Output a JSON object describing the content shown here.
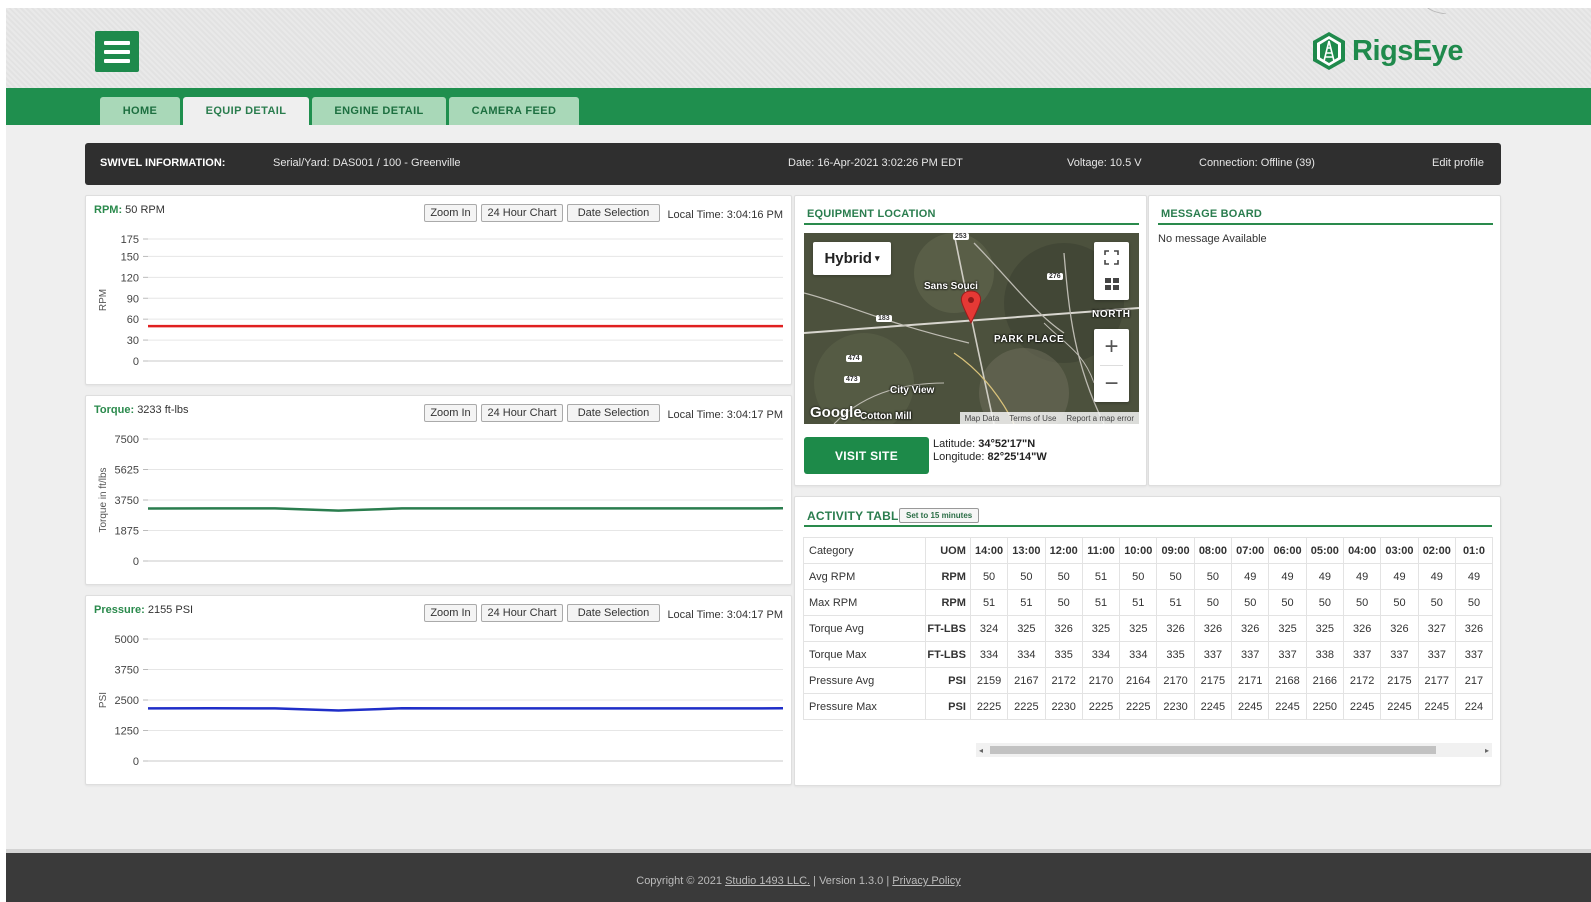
{
  "header": {
    "brand": "RigsEye"
  },
  "nav": {
    "tabs": [
      {
        "label": "HOME"
      },
      {
        "label": "EQUIP DETAIL"
      },
      {
        "label": "ENGINE DETAIL"
      },
      {
        "label": "CAMERA FEED"
      }
    ]
  },
  "info": {
    "label": "SWIVEL INFORMATION:",
    "serial": "Serial/Yard: DAS001 / 100 - Greenville",
    "date": "Date: 16-Apr-2021 3:02:26 PM EDT",
    "voltage": "Voltage: 10.5 V",
    "connection": "Connection: Offline (39)",
    "edit": "Edit profile"
  },
  "buttons": {
    "zoom": "Zoom In",
    "h24": "24 Hour Chart",
    "date": "Date Selection"
  },
  "rpm": {
    "label": "RPM:",
    "value": "50 RPM",
    "localtime": "Local Time: 3:04:16 PM"
  },
  "torque": {
    "label": "Torque:",
    "value": "3233 ft-lbs",
    "localtime": "Local Time: 3:04:17 PM"
  },
  "pressure": {
    "label": "Pressure:",
    "value": "2155 PSI",
    "localtime": "Local Time: 3:04:17 PM"
  },
  "chart_data": [
    {
      "type": "line",
      "title": "RPM",
      "ylabel": "RPM",
      "yticks": [
        0,
        30,
        60,
        90,
        120,
        150,
        175
      ],
      "ylim": [
        0,
        175
      ],
      "series": [
        {
          "color": "#e02020",
          "values": [
            50,
            50,
            50,
            50,
            50,
            50,
            50,
            50,
            50,
            50,
            50
          ]
        }
      ]
    },
    {
      "type": "line",
      "title": "Torque",
      "ylabel": "Torque in ft/lbs",
      "yticks": [
        0,
        1875,
        3750,
        5625,
        7500
      ],
      "ylim": [
        0,
        7500
      ],
      "series": [
        {
          "color": "#2a7d4e",
          "values": [
            3230,
            3235,
            3233,
            3100,
            3235,
            3233,
            3234,
            3233,
            3235,
            3234,
            3240
          ]
        }
      ]
    },
    {
      "type": "line",
      "title": "Pressure",
      "ylabel": "PSI",
      "yticks": [
        0,
        1250,
        2500,
        3750,
        5000
      ],
      "ylim": [
        0,
        5000
      ],
      "series": [
        {
          "color": "#1f2ec8",
          "values": [
            2155,
            2160,
            2155,
            2070,
            2158,
            2155,
            2157,
            2155,
            2156,
            2155,
            2160
          ]
        }
      ]
    }
  ],
  "location": {
    "title": "EQUIPMENT LOCATION",
    "map_type": "Hybrid",
    "map_labels": [
      "Sans Souci",
      "PARK PLACE",
      "NORTH",
      "City View",
      "Cotton Mill"
    ],
    "road_badges": [
      "253",
      "276",
      "183",
      "474",
      "473"
    ],
    "attribution": [
      "Map Data",
      "Terms of Use",
      "Report a map error"
    ],
    "google": "Google",
    "visit": "VISIT SITE",
    "lat_label": "Latitude:",
    "lat": "34°52'17\"N",
    "lon_label": "Longitude:",
    "lon": "82°25'14\"W"
  },
  "messages": {
    "title": "MESSAGE BOARD",
    "empty": "No message Available"
  },
  "activity": {
    "title": "ACTIVITY TABLE",
    "badge": "Set to 15 minutes",
    "cat_header": "Category",
    "uom_header": "UOM",
    "hours": [
      "14:00",
      "13:00",
      "12:00",
      "11:00",
      "10:00",
      "09:00",
      "08:00",
      "07:00",
      "06:00",
      "05:00",
      "04:00",
      "03:00",
      "02:00",
      "01:0"
    ],
    "rows": [
      {
        "cat": "Avg RPM",
        "uom": "RPM",
        "vals": [
          "50",
          "50",
          "50",
          "51",
          "50",
          "50",
          "50",
          "49",
          "49",
          "49",
          "49",
          "49",
          "49",
          "49"
        ]
      },
      {
        "cat": "Max RPM",
        "uom": "RPM",
        "vals": [
          "51",
          "51",
          "50",
          "51",
          "51",
          "51",
          "50",
          "50",
          "50",
          "50",
          "50",
          "50",
          "50",
          "50"
        ]
      },
      {
        "cat": "Torque Avg",
        "uom": "FT-LBS",
        "vals": [
          "324",
          "325",
          "326",
          "325",
          "325",
          "326",
          "326",
          "326",
          "325",
          "325",
          "326",
          "326",
          "327",
          "326"
        ]
      },
      {
        "cat": "Torque Max",
        "uom": "FT-LBS",
        "vals": [
          "334",
          "334",
          "335",
          "334",
          "334",
          "335",
          "337",
          "337",
          "337",
          "338",
          "337",
          "337",
          "337",
          "337"
        ]
      },
      {
        "cat": "Pressure Avg",
        "uom": "PSI",
        "vals": [
          "2159",
          "2167",
          "2172",
          "2170",
          "2164",
          "2170",
          "2175",
          "2171",
          "2168",
          "2166",
          "2172",
          "2175",
          "2177",
          "217"
        ]
      },
      {
        "cat": "Pressure Max",
        "uom": "PSI",
        "vals": [
          "2225",
          "2225",
          "2230",
          "2225",
          "2225",
          "2230",
          "2245",
          "2245",
          "2245",
          "2250",
          "2245",
          "2245",
          "2245",
          "224"
        ]
      }
    ]
  },
  "footer": {
    "copyright": "Copyright © 2021",
    "company": "Studio 1493 LLC.",
    "version": "| Version 1.3.0 |",
    "privacy": "Privacy Policy"
  }
}
